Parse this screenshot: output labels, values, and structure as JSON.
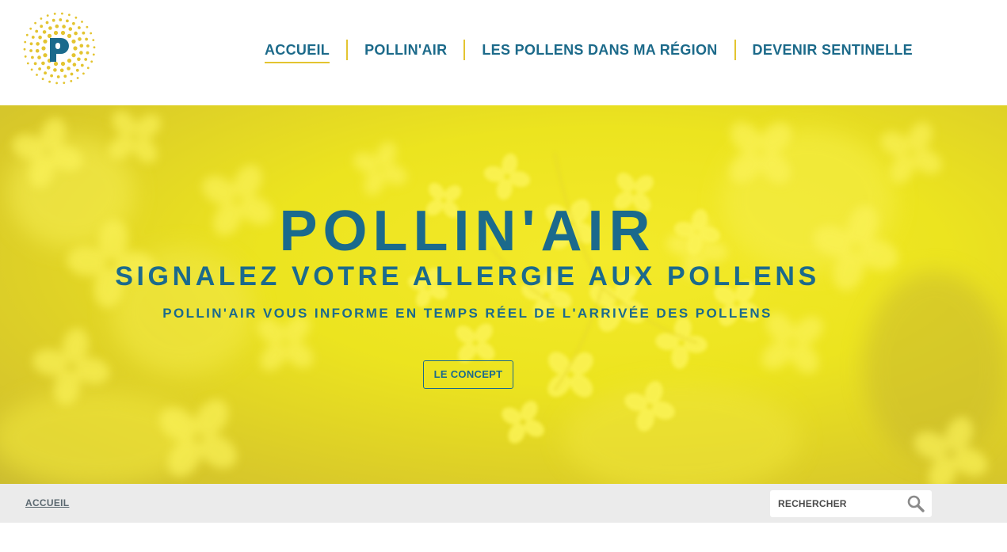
{
  "brand": {
    "logo_letter": "P"
  },
  "nav": {
    "items": [
      {
        "label": "ACCUEIL"
      },
      {
        "label": "POLLIN'AIR"
      },
      {
        "label": "LES POLLENS DANS MA RÉGION"
      },
      {
        "label": "DEVENIR SENTINELLE"
      }
    ]
  },
  "hero": {
    "title": "POLLIN'AIR",
    "subtitle": "SIGNALEZ VOTRE ALLERGIE AUX POLLENS",
    "tagline": "POLLIN'AIR VOUS INFORME EN TEMPS RÉEL DE L'ARRIVÉE DES POLLENS",
    "cta_label": "LE CONCEPT"
  },
  "breadcrumb": {
    "current": "ACCUEIL"
  },
  "search": {
    "placeholder": "RECHERCHER",
    "value": ""
  },
  "colors": {
    "primary": "#1b6a8c",
    "accent": "#e3c430",
    "hero_yellow": "#ece41f",
    "bar_gray": "#ebebeb"
  },
  "icons": {
    "search": "search-icon",
    "logo": "pollinair-logo"
  }
}
